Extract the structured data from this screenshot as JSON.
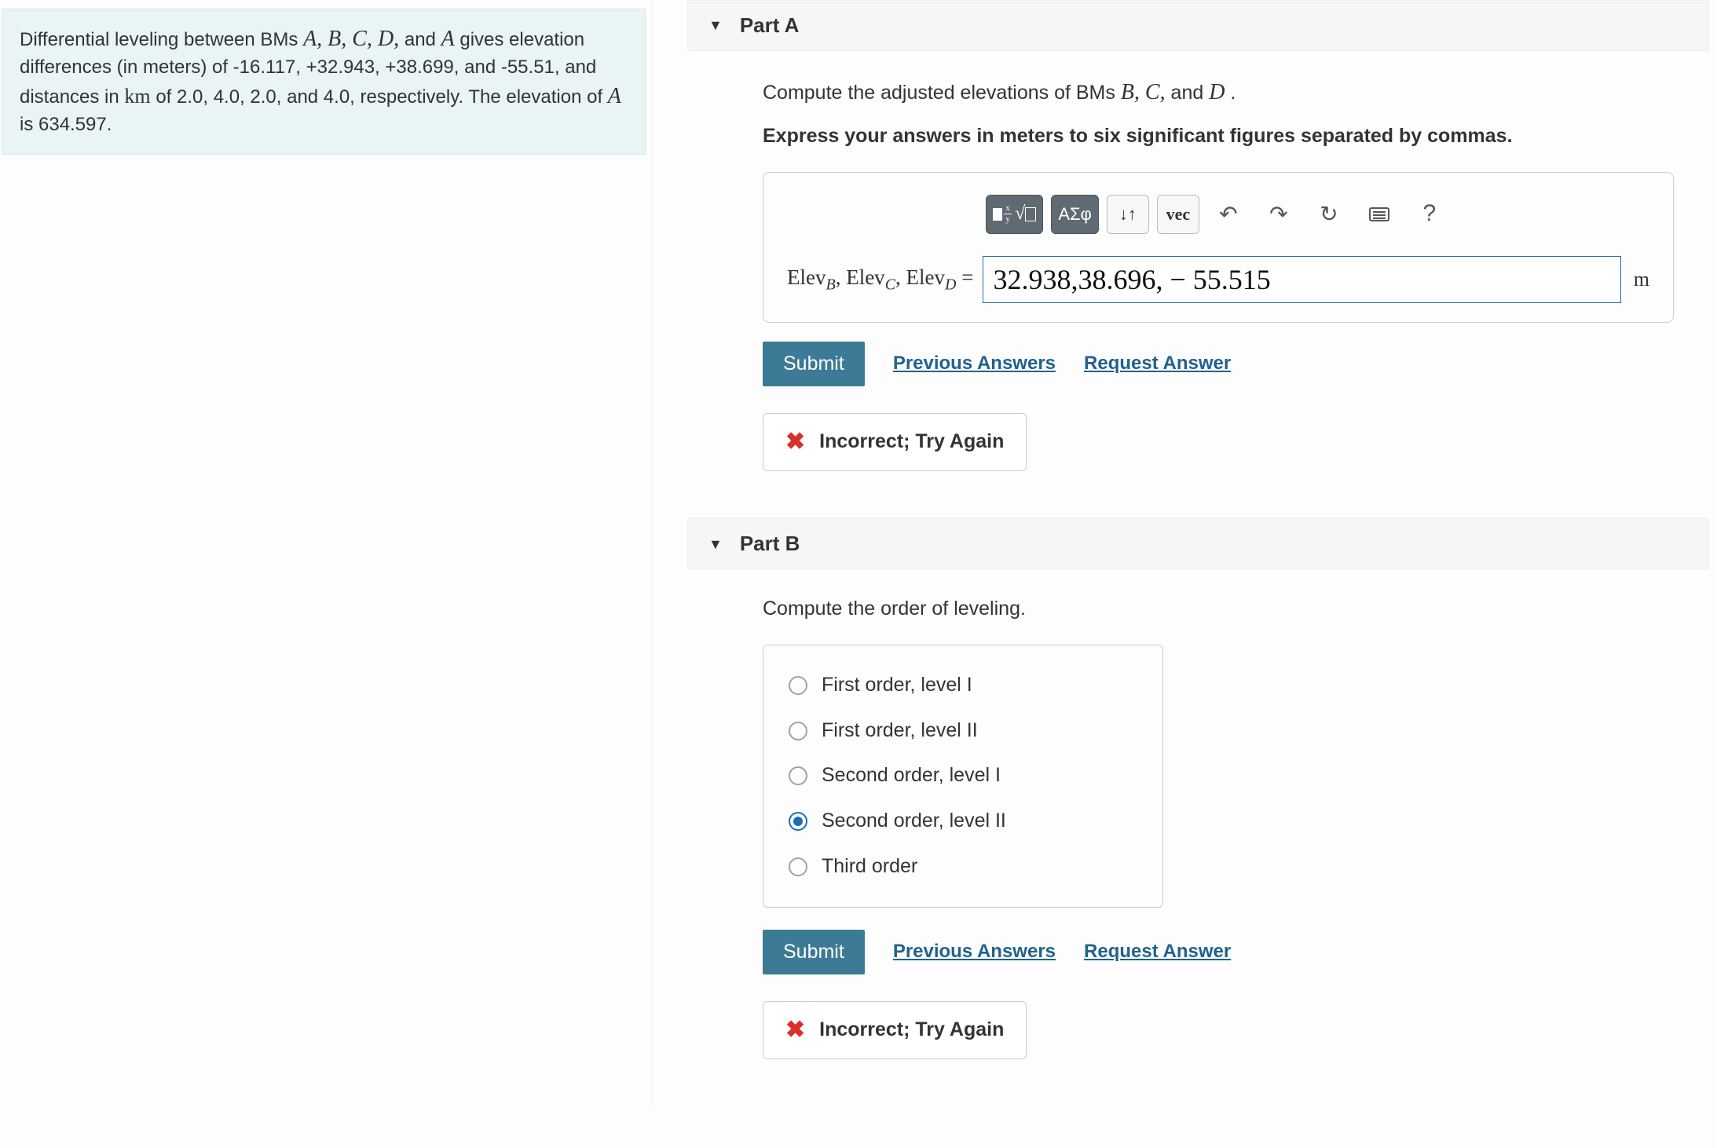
{
  "problem": {
    "text_before": "Differential leveling between BMs ",
    "bms": "A, B, C, D,",
    "and": " and ",
    "bm_last": "A",
    "text_mid1": " gives elevation differences (in meters) of -16.117, +32.943, +38.699, and -55.51, and distances in ",
    "km": "km",
    "text_mid2": " of 2.0, 4.0, 2.0, and 4.0, respectively. The elevation of ",
    "bm_a": "A",
    "text_end": " is 634.597."
  },
  "partA": {
    "header": "Part A",
    "instr_before": "Compute the adjusted elevations of BMs ",
    "instr_bms": "B, C,",
    "instr_and": " and ",
    "instr_bm_last": "D",
    "instr_after": ".",
    "instr2": "Express your answers in meters to six significant figures separated by commas.",
    "toolbar": {
      "greek": "ΑΣφ",
      "updown": "↓↑",
      "vec": "vec",
      "undo": "↶",
      "redo": "↷",
      "reset": "↻",
      "help": "?"
    },
    "label_html": "Elev_B, Elev_C, Elev_D =",
    "value": "32.938,38.696, − 55.515",
    "unit": "m",
    "submit": "Submit",
    "prev": "Previous Answers",
    "req": "Request Answer",
    "feedback": "Incorrect; Try Again"
  },
  "partB": {
    "header": "Part B",
    "instr": "Compute the order of leveling.",
    "options": [
      "First order, level I",
      "First order, level II",
      "Second order, level I",
      "Second order, level II",
      "Third order"
    ],
    "selected_index": 3,
    "submit": "Submit",
    "prev": "Previous Answers",
    "req": "Request Answer",
    "feedback": "Incorrect; Try Again"
  }
}
